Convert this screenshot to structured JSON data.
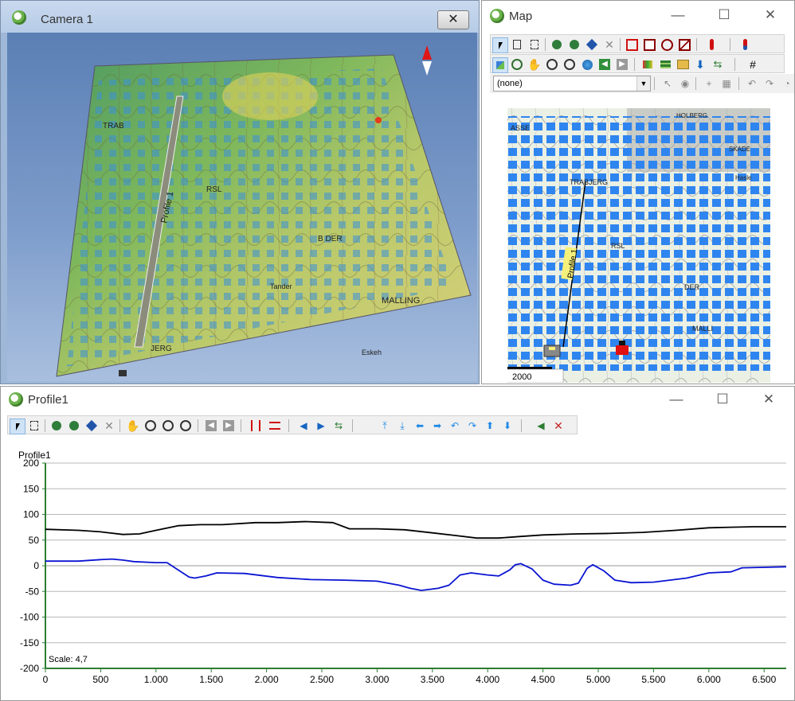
{
  "camera_window": {
    "title": "Camera 1",
    "close_symbol": "✕",
    "map_labels": [
      "TRAB",
      "RSL",
      "B DER",
      "Tander",
      "MALLING",
      "JERG",
      "Eskeh"
    ],
    "profile_label": "Profile 1",
    "compass_icon": "north-arrow"
  },
  "map_window": {
    "title": "Map",
    "layer_combo_value": "(none)",
    "map_labels": [
      "ASSE",
      "TRABJERG",
      "RSL",
      "DER",
      "MALLI",
      "HOLBERG",
      "SKADE",
      "Hasle"
    ],
    "profile_label": "Profile 1",
    "scale_bar_label": "2000",
    "tools_row1": [
      "select-icon",
      "select-node-icon",
      "select-add-icon",
      "rotate-left-icon",
      "rotate-right-icon",
      "pointer-star-icon",
      "delete-icon",
      "rect-icon",
      "rect-fill-icon",
      "gear-icon",
      "slash-icon",
      "thermometer-icon",
      "thermometer2-icon"
    ],
    "tools_row2": [
      "map-select-icon",
      "zoom-box-icon",
      "pan-hand-icon",
      "zoom-in-icon",
      "zoom-out-icon",
      "globe-icon",
      "back-icon",
      "forward-icon",
      "paint-icon",
      "layers-icon",
      "folder-icon",
      "download-icon",
      "refresh-icon",
      "grid-icon"
    ]
  },
  "profile_window": {
    "title": "Profile1",
    "tools": [
      "select-icon",
      "select-add-icon",
      "rotate-left-icon",
      "rotate-right-icon",
      "pointer-star-icon",
      "delete-icon",
      "pan-hand-icon",
      "zoom-in-icon",
      "zoom-out-icon",
      "zoom-extent-icon",
      "back-icon",
      "forward-icon",
      "vertical-lines-icon",
      "horizontal-lines-icon",
      "triangle-left-icon",
      "triangle-right-icon",
      "refresh-icon",
      "top-icon",
      "bottom-icon",
      "arrow-left-icon",
      "arrow-right-icon",
      "undo-icon",
      "redo-icon",
      "arrow-up-icon",
      "arrow-down-icon",
      "speaker-icon",
      "speaker-mute-icon"
    ]
  },
  "chart_data": {
    "type": "line",
    "title": "Profile1",
    "scale_label": "Scale: 4,7",
    "xlim": [
      0,
      6700
    ],
    "ylim": [
      -200,
      200
    ],
    "x_ticks": [
      0,
      500,
      1000,
      1500,
      2000,
      2500,
      3000,
      3500,
      4000,
      4500,
      5000,
      5500,
      6000,
      6500
    ],
    "x_tick_labels": [
      "0",
      "500",
      "1.000",
      "1.500",
      "2.000",
      "2.500",
      "3.000",
      "3.500",
      "4.000",
      "4.500",
      "5.000",
      "5.500",
      "6.000",
      "6.500"
    ],
    "y_ticks": [
      200,
      150,
      100,
      50,
      0,
      -50,
      -100,
      -150,
      -200
    ],
    "y_tick_labels": [
      "200",
      "150",
      "100",
      "50",
      "0",
      "-50",
      "-100",
      "-150",
      "-200"
    ],
    "grid": true,
    "series": [
      {
        "color": "#000000",
        "x": [
          0,
          300,
          500,
          700,
          850,
          1000,
          1200,
          1400,
          1600,
          1900,
          2100,
          2350,
          2600,
          2750,
          3000,
          3250,
          3500,
          3700,
          3900,
          4100,
          4300,
          4500,
          4800,
          5100,
          5400,
          5700,
          6000,
          6200,
          6400,
          6700
        ],
        "y": [
          71,
          69,
          66,
          61,
          62,
          69,
          78,
          80,
          80,
          84,
          84,
          86,
          84,
          72,
          72,
          70,
          64,
          59,
          54,
          54,
          57,
          60,
          62,
          63,
          65,
          69,
          74,
          75,
          76,
          76
        ]
      },
      {
        "color": "#0a14d2",
        "x": [
          0,
          300,
          500,
          600,
          700,
          800,
          1000,
          1100,
          1200,
          1300,
          1350,
          1450,
          1550,
          1800,
          2100,
          2400,
          2700,
          3000,
          3200,
          3300,
          3400,
          3550,
          3650,
          3750,
          3850,
          4000,
          4100,
          4200,
          4250,
          4300,
          4400,
          4500,
          4600,
          4750,
          4820,
          4900,
          4950,
          5050,
          5150,
          5300,
          5500,
          5800,
          6000,
          6200,
          6300,
          6700
        ],
        "y": [
          9,
          9,
          12,
          13,
          11,
          8,
          6,
          6,
          -8,
          -22,
          -24,
          -20,
          -14,
          -15,
          -23,
          -27,
          -28,
          -30,
          -38,
          -44,
          -48,
          -44,
          -38,
          -18,
          -14,
          -18,
          -20,
          -8,
          2,
          4,
          -6,
          -28,
          -36,
          -38,
          -34,
          -5,
          2,
          -10,
          -28,
          -33,
          -32,
          -24,
          -14,
          -12,
          -4,
          -2
        ]
      }
    ]
  }
}
